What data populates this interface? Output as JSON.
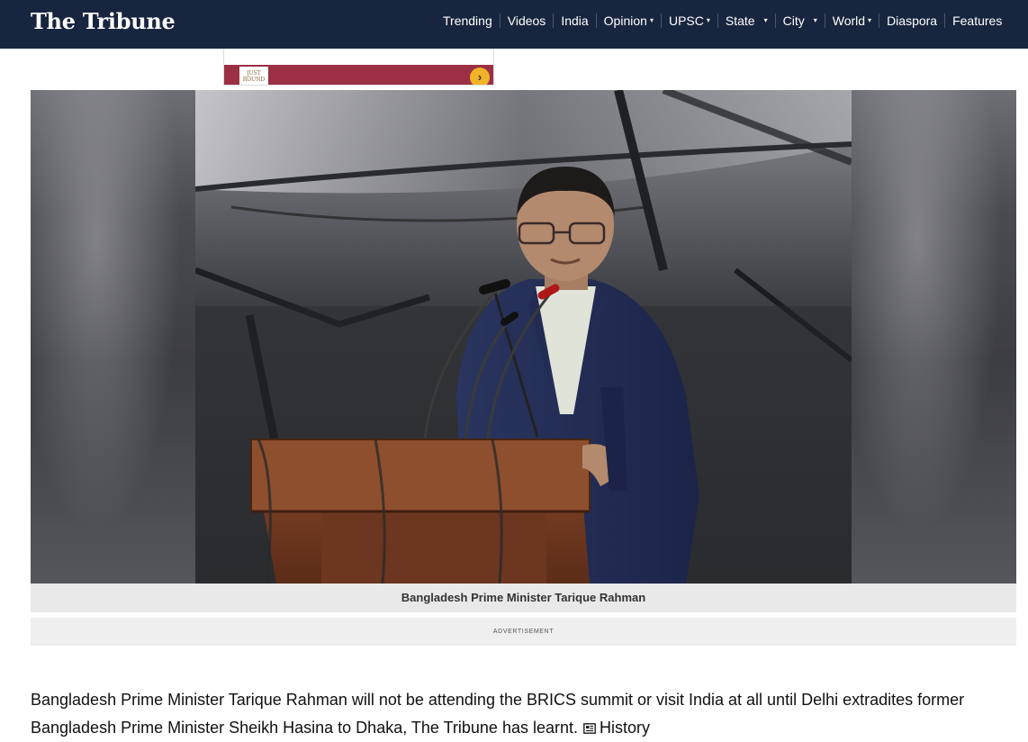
{
  "site": {
    "logo_text": "The Tribune"
  },
  "nav": {
    "items": [
      {
        "label": "Trending",
        "has_menu": false
      },
      {
        "label": "Videos",
        "has_menu": false
      },
      {
        "label": "India",
        "has_menu": false
      },
      {
        "label": "Opinion",
        "has_menu": true
      },
      {
        "label": "UPSC",
        "has_menu": true
      },
      {
        "label": "State",
        "has_menu": true
      },
      {
        "label": "City",
        "has_menu": true
      },
      {
        "label": "World",
        "has_menu": true
      },
      {
        "label": "Diaspora",
        "has_menu": false
      },
      {
        "label": "Features",
        "has_menu": false
      }
    ],
    "caret_glyph": "▾"
  },
  "top_ad": {
    "logo_text": "JUST ROUND",
    "arrow_glyph": "›",
    "brand_color": "#9b3045",
    "arrow_color": "#f0b429"
  },
  "article": {
    "image_caption": "Bangladesh Prime Minister Tarique Rahman",
    "advertisement_label": "ADVERTISEMENT",
    "lead_text": "Bangladesh Prime Minister Tarique Rahman will not be attending the BRICS summit or visit India at all until Delhi extradites former Bangladesh Prime Minister Sheikh Hasina to Dhaka, The Tribune has learnt.",
    "history_link_label": "History",
    "history_icon": "newspaper-icon"
  },
  "colors": {
    "header_bg": "#18253f",
    "caption_bg": "#e9e9e9",
    "advert_bg": "#efefef"
  }
}
